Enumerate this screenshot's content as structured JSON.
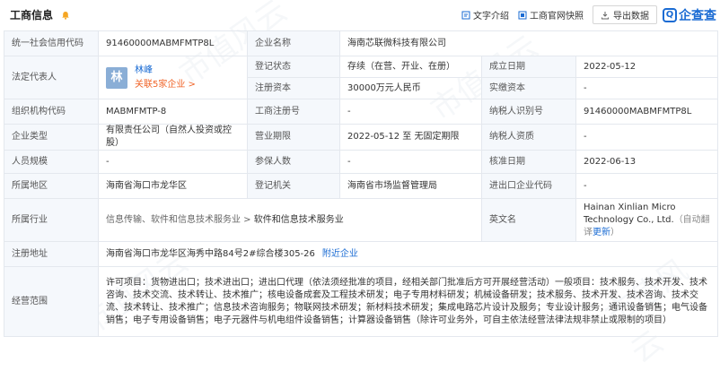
{
  "header": {
    "title": "工商信息",
    "links": [
      "文字介绍",
      "工商官网快照"
    ],
    "export_label": "导出数据",
    "logo_text": "企查查"
  },
  "fields": {
    "credit_code": {
      "label": "统一社会信用代码",
      "value": "91460000MABMFMTP8L"
    },
    "company_name": {
      "label": "企业名称",
      "value": "海南芯联微科技有限公司"
    },
    "legal_rep": {
      "label": "法定代表人",
      "avatar": "林",
      "name": "林峰",
      "related": "关联5家企业 >"
    },
    "reg_status": {
      "label": "登记状态",
      "value": "存续（在营、开业、在册）"
    },
    "est_date": {
      "label": "成立日期",
      "value": "2022-05-12"
    },
    "reg_capital": {
      "label": "注册资本",
      "value": "30000万元人民币"
    },
    "paid_capital": {
      "label": "实缴资本",
      "value": "-"
    },
    "org_code": {
      "label": "组织机构代码",
      "value": "MABMFMTP-8"
    },
    "biz_reg_no": {
      "label": "工商注册号",
      "value": "-"
    },
    "taxpayer_id": {
      "label": "纳税人识别号",
      "value": "91460000MABMFMTP8L"
    },
    "company_type": {
      "label": "企业类型",
      "value": "有限责任公司（自然人投资或控股）"
    },
    "biz_term": {
      "label": "营业期限",
      "value": "2022-05-12 至 无固定期限"
    },
    "taxpayer_qual": {
      "label": "纳税人资质",
      "value": "-"
    },
    "staff_size": {
      "label": "人员规模",
      "value": "-"
    },
    "insured": {
      "label": "参保人数",
      "value": "-"
    },
    "approval_date": {
      "label": "核准日期",
      "value": "2022-06-13"
    },
    "region": {
      "label": "所属地区",
      "value": "海南省海口市龙华区"
    },
    "reg_authority": {
      "label": "登记机关",
      "value": "海南省市场监督管理局"
    },
    "ie_code": {
      "label": "进出口企业代码",
      "value": "-"
    },
    "industry": {
      "label": "所属行业",
      "path": "信息传输、软件和信息技术服务业 > ",
      "leaf": "软件和信息技术服务业"
    },
    "en_name": {
      "label": "英文名",
      "value": "Hainan Xinlian Micro Technology Co., Ltd.",
      "note": "（自动翻译",
      "update": "更新",
      "close": "）"
    },
    "address": {
      "label": "注册地址",
      "value": "海南省海口市龙华区海秀中路84号2#综合楼305-26",
      "link": "附近企业"
    },
    "scope": {
      "label": "经营范围",
      "value": "许可项目：货物进出口；技术进出口；进出口代理（依法须经批准的项目，经相关部门批准后方可开展经营活动）一般项目：技术服务、技术开发、技术咨询、技术交流、技术转让、技术推广；核电设备成套及工程技术研发；电子专用材料研发；机械设备研发；技术服务、技术开发、技术咨询、技术交流、技术转让、技术推广；信息技术咨询服务；物联网技术研发；新材料技术研发；集成电路芯片设计及服务；专业设计服务；通讯设备销售；电气设备销售；电子专用设备销售；电子元器件与机电组件设备销售；计算器设备销售（除许可业务外，可自主依法经营法律法规非禁止或限制的项目）"
    }
  }
}
